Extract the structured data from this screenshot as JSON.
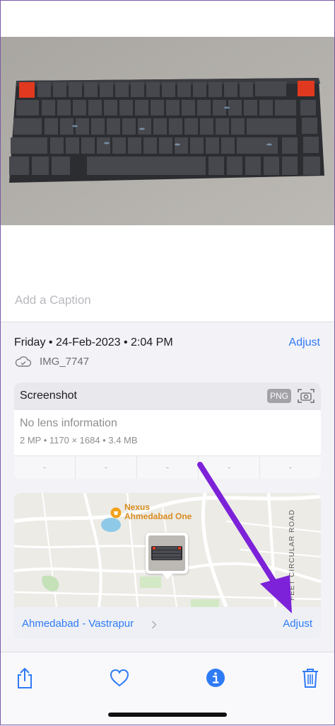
{
  "caption": {
    "placeholder": "Add a Caption"
  },
  "details": {
    "date_time": "Friday • 24-Feb-2023 • 2:04 PM",
    "adjust_label": "Adjust",
    "filename": "IMG_7747"
  },
  "capture_card": {
    "title": "Screenshot",
    "format_badge": "PNG",
    "lens": "No lens information",
    "specs": "2 MP  •  1170 × 1684  •  3.4 MB",
    "exif": [
      "-",
      "-",
      "-",
      "-",
      "-"
    ]
  },
  "map": {
    "poi_line1": "Nexus",
    "poi_line2": "Ahmedabad One",
    "road_label": "FEET CIRCULAR ROAD",
    "location_name": "Ahmedabad - Vastrapur",
    "adjust_label": "Adjust"
  },
  "toolbar": {
    "icons": [
      "share-icon",
      "heart-icon",
      "info-icon",
      "trash-icon"
    ]
  },
  "colors": {
    "accent": "#2f7bf5",
    "annotation_arrow": "#7d22d8",
    "panel_bg": "#f2f2f7"
  }
}
